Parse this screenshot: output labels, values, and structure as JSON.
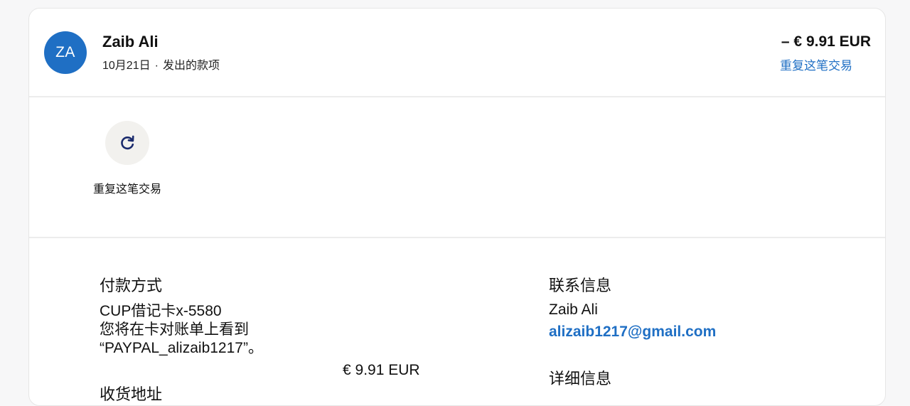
{
  "transaction": {
    "avatar_initials": "ZA",
    "name": "Zaib Ali",
    "date": "10月21日",
    "separator": "·",
    "type": "发出的款项",
    "amount": "– € 9.91 EUR",
    "repeat_link": "重复这笔交易"
  },
  "actions": {
    "repeat_label": "重复这笔交易",
    "repeat_icon": "refresh-icon"
  },
  "payment": {
    "title": "付款方式",
    "method": "CUP借记卡x-5580",
    "statement_line1": "您将在卡对账单上看到",
    "statement_line2": "“PAYPAL_alizaib1217”。",
    "amount": "€ 9.91 EUR"
  },
  "shipping": {
    "title": "收货地址"
  },
  "contact": {
    "title": "联系信息",
    "name": "Zaib Ali",
    "email": "alizaib1217@gmail.com"
  },
  "details": {
    "title": "详细信息"
  },
  "colors": {
    "accent": "#1f6fc4",
    "action_bg": "#f2f1ee",
    "icon_navy": "#1a2a6c"
  }
}
